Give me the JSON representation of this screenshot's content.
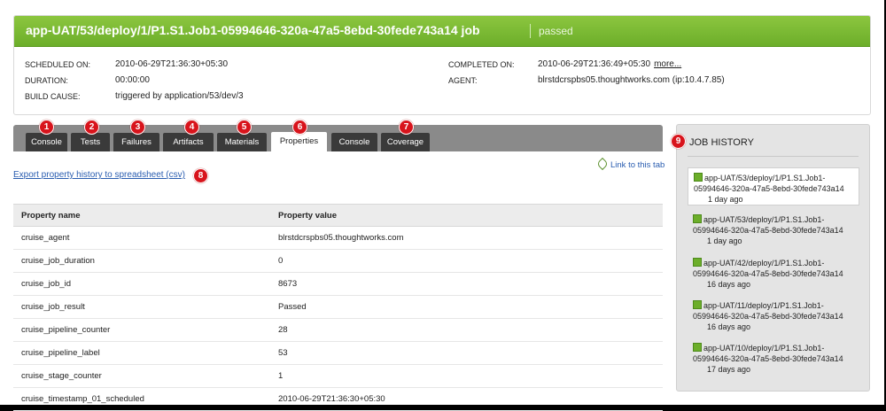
{
  "header": {
    "title": "app-UAT/53/deploy/1/P1.S1.Job1-05994646-320a-47a5-8ebd-30fede743a14 job",
    "status": "passed",
    "scheduled_label": "SCHEDULED ON:",
    "scheduled_value": "2010-06-29T21:36:30+05:30",
    "duration_label": "DURATION:",
    "duration_value": "00:00:00",
    "build_cause_label": "BUILD CAUSE:",
    "build_cause_value": "triggered by application/53/dev/3",
    "completed_label": "COMPLETED ON:",
    "completed_value": "2010-06-29T21:36:49+05:30",
    "more_link": "more...",
    "agent_label": "AGENT:",
    "agent_value": "blrstdcrspbs05.thoughtworks.com (ip:10.4.7.85)"
  },
  "tabs": [
    {
      "label": "Console",
      "badge": "1"
    },
    {
      "label": "Tests",
      "badge": "2"
    },
    {
      "label": "Failures",
      "badge": "3"
    },
    {
      "label": "Artifacts",
      "badge": "4"
    },
    {
      "label": "Materials",
      "badge": "5"
    },
    {
      "label": "Properties",
      "badge": "6",
      "active": true
    },
    {
      "label": "Console",
      "badge": ""
    },
    {
      "label": "Coverage",
      "badge": "7"
    }
  ],
  "export": {
    "label": "Export property history to spreadsheet (csv)",
    "badge": "8"
  },
  "link_to_tab": "Link to this tab",
  "properties": {
    "headers": [
      "Property name",
      "Property value"
    ],
    "rows": [
      [
        "cruise_agent",
        "blrstdcrspbs05.thoughtworks.com"
      ],
      [
        "cruise_job_duration",
        "0"
      ],
      [
        "cruise_job_id",
        "8673"
      ],
      [
        "cruise_job_result",
        "Passed"
      ],
      [
        "cruise_pipeline_counter",
        "28"
      ],
      [
        "cruise_pipeline_label",
        "53"
      ],
      [
        "cruise_stage_counter",
        "1"
      ],
      [
        "cruise_timestamp_01_scheduled",
        "2010-06-29T21:36:30+05:30"
      ]
    ]
  },
  "job_history": {
    "title": "JOB HISTORY",
    "badge": "9",
    "items": [
      {
        "line1": "app-UAT/53/deploy/1/P1.S1.Job1-",
        "line2": "05994646-320a-47a5-8ebd-30fede743a14",
        "ago": "1 day ago"
      },
      {
        "line1": "app-UAT/53/deploy/1/P1.S1.Job1-",
        "line2": "05994646-320a-47a5-8ebd-30fede743a14",
        "ago": "1 day ago"
      },
      {
        "line1": "app-UAT/42/deploy/1/P1.S1.Job1-",
        "line2": "05994646-320a-47a5-8ebd-30fede743a14",
        "ago": "16 days ago"
      },
      {
        "line1": "app-UAT/11/deploy/1/P1.S1.Job1-",
        "line2": "05994646-320a-47a5-8ebd-30fede743a14",
        "ago": "16 days ago"
      },
      {
        "line1": "app-UAT/10/deploy/1/P1.S1.Job1-",
        "line2": "05994646-320a-47a5-8ebd-30fede743a14",
        "ago": "17 days ago"
      }
    ]
  },
  "colors": {
    "header_green": "#7bbd35",
    "badge_red": "#d8141c",
    "tab_dark": "#3a3a3a",
    "link_blue": "#2a5db0"
  }
}
